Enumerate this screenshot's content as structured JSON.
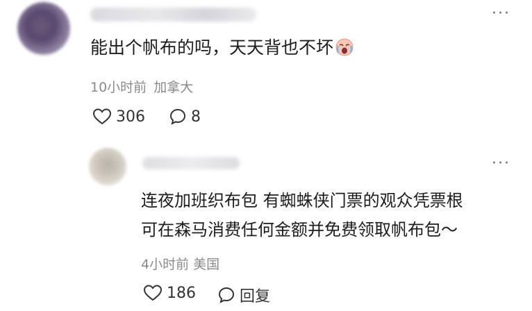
{
  "comments": [
    {
      "text": "能出个帆布的吗，天天背也不坏",
      "emoji": "crying-face-emoji",
      "time": "10小时前",
      "location": "加拿大",
      "likes": "306",
      "replies": "8",
      "more": "···"
    }
  ],
  "reply": {
    "line1": "连夜加班织布包 有蜘蛛侠门票的观众凭票根",
    "line2": "可在森马消费任何金额并免费领取帆布包～",
    "time": "4小时前",
    "location": "美国",
    "likes": "186",
    "reply_label": "回复",
    "more": "···"
  }
}
